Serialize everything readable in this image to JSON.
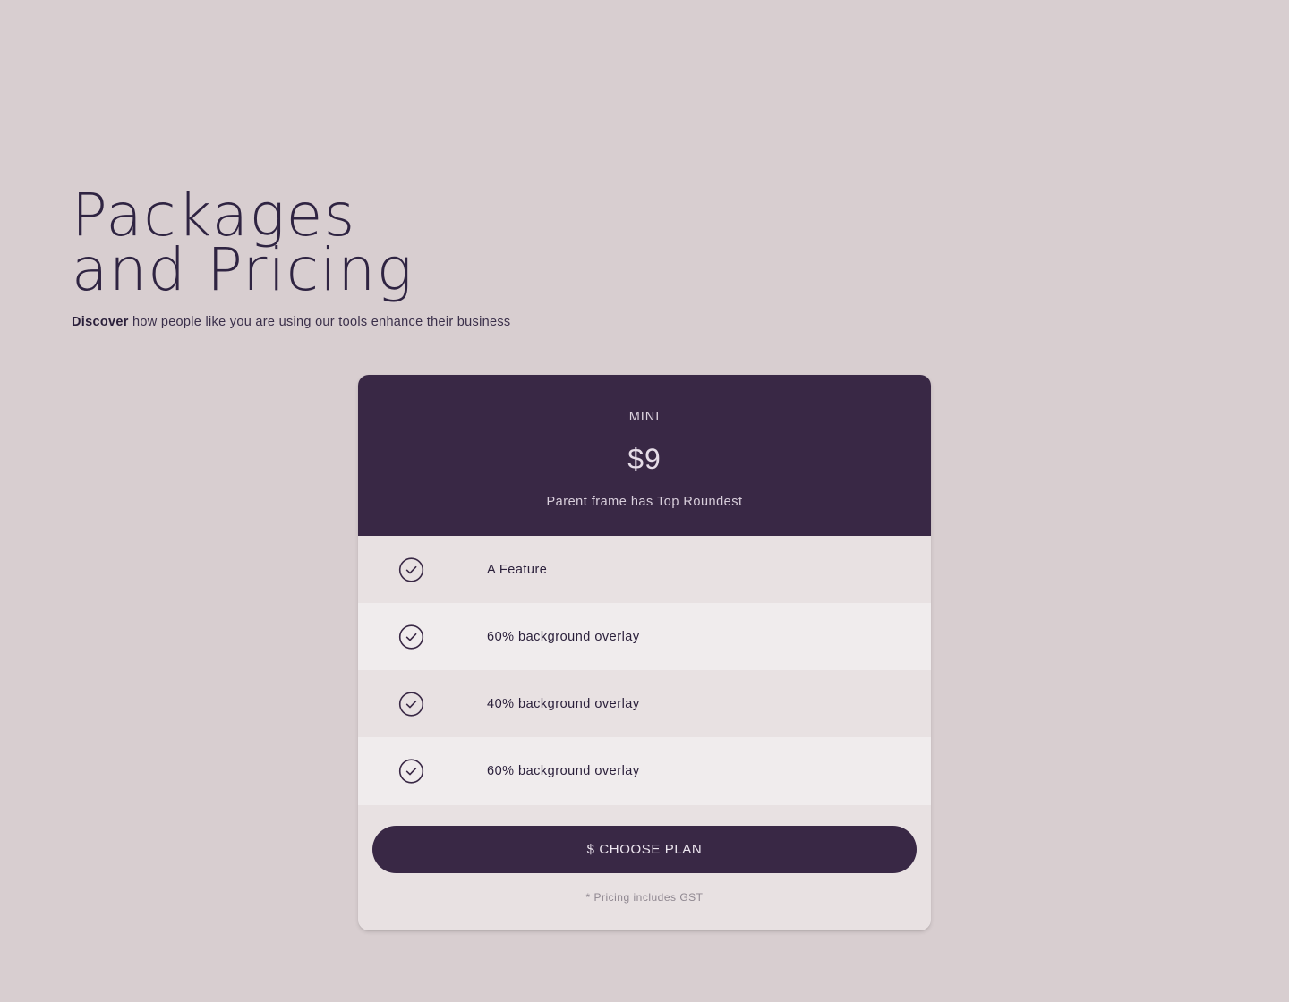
{
  "hero": {
    "title_line1": "Packages",
    "title_line2": "and Pricing",
    "subtitle_strong": "Discover",
    "subtitle_rest": " how people like you are using our tools enhance their business"
  },
  "plan": {
    "name": "MINI",
    "price": "$9",
    "description": "Parent frame has Top Roundest",
    "features": [
      {
        "label": "A Feature",
        "icon": "check-circle-icon"
      },
      {
        "label": "60% background overlay",
        "icon": "check-circle-icon"
      },
      {
        "label": "40% background overlay",
        "icon": "check-circle-icon"
      },
      {
        "label": "60% background overlay",
        "icon": "check-circle-icon"
      }
    ],
    "cta_label": "$ CHOOSE PLAN",
    "footnote": "* Pricing includes GST"
  },
  "colors": {
    "page_background": "#d8ced0",
    "accent": "#392845",
    "text_dark": "#2a1f3a"
  }
}
